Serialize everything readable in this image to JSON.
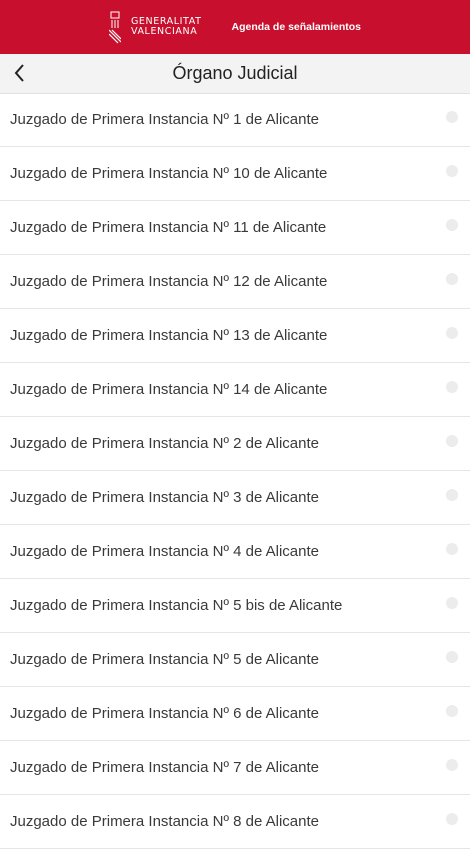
{
  "header": {
    "logo_line1": "GENERALITAT",
    "logo_line2": "VALENCIANA",
    "app_name": "Agenda de señalamientos",
    "brand_color": "#c8102e"
  },
  "nav": {
    "back_icon": "chevron-left-icon",
    "title": "Órgano Judicial"
  },
  "list": {
    "items": [
      {
        "label": "Juzgado de Primera Instancia Nº 1 de Alicante"
      },
      {
        "label": "Juzgado de Primera Instancia Nº 10 de Alicante"
      },
      {
        "label": "Juzgado de Primera Instancia Nº 11 de Alicante"
      },
      {
        "label": "Juzgado de Primera Instancia Nº 12 de Alicante"
      },
      {
        "label": "Juzgado de Primera Instancia Nº 13 de Alicante"
      },
      {
        "label": "Juzgado de Primera Instancia Nº 14 de Alicante"
      },
      {
        "label": "Juzgado de Primera Instancia Nº 2 de Alicante"
      },
      {
        "label": "Juzgado de Primera Instancia Nº 3 de Alicante"
      },
      {
        "label": "Juzgado de Primera Instancia Nº 4 de Alicante"
      },
      {
        "label": "Juzgado de Primera Instancia Nº 5 bis de Alicante"
      },
      {
        "label": "Juzgado de Primera Instancia Nº 5 de Alicante"
      },
      {
        "label": "Juzgado de Primera Instancia Nº 6 de Alicante"
      },
      {
        "label": "Juzgado de Primera Instancia Nº 7 de Alicante"
      },
      {
        "label": "Juzgado de Primera Instancia Nº 8 de Alicante"
      }
    ]
  }
}
